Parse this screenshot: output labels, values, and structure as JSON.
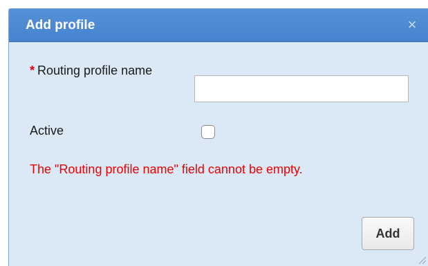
{
  "dialog": {
    "title": "Add profile",
    "close_icon": "close-icon",
    "close_glyph": "×"
  },
  "form": {
    "required_marker": "*",
    "name_label": "Routing profile name",
    "name_value": "",
    "name_placeholder": "",
    "active_label": "Active",
    "active_checked": false,
    "error_message": "The \"Routing profile name\" field cannot be empty."
  },
  "buttons": {
    "add_label": "Add"
  },
  "colors": {
    "titlebar": "#4683cf",
    "dialog_bg": "#dbe8f5",
    "error": "#ee0000"
  }
}
